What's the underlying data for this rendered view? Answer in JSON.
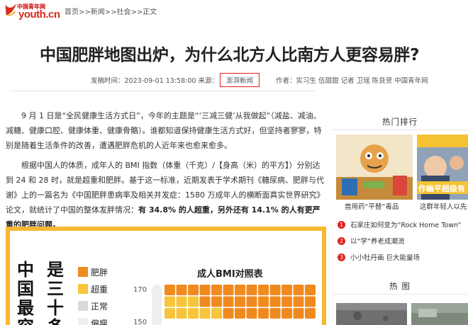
{
  "header": {
    "logo_cn": "中国青年网",
    "logo_en": "youth.cn",
    "breadcrumb": [
      "首页",
      ">>",
      "新闻",
      ">>",
      "社会",
      ">>",
      "正文"
    ]
  },
  "article": {
    "title": "中国肥胖地图出炉，为什么北方人比南方人更容易胖?",
    "publish_label": "发稿时间：",
    "publish_time": "2023-09-01 13:58:00",
    "source_label": "来源：",
    "source": "澎湃新闻",
    "author_label": "作者：",
    "authors": "实习生 伍甜甜 记者 卫瑶 陈良贤 中国青年网",
    "p1": "9 月 1 日是“全民健康生活方式日”，今年的主题是“‘三减三健’从我做起”（减盐、减油、减糖、健康口腔、健康体重、健康骨骼）。谁都知道保持健康生活方式好，但坚持者寥寥，特别是随着生活条件的改善，遭遇肥胖危机的人近年来也愈来愈多。",
    "p2_a": "根据中国人的体质，成年人的 BMI 指数（体重（千克）/【身高（米）的平方】）分别达到 24 和 28 时，就是超重和肥胖。基于这一标准，近期发表于学术期刊《糖尿病、肥胖与代谢》上的一篇名为《中国肥胖患病率及相关并发症：1580 万成年人的横断面真实世界研究》论文，就统计了中国的整体发胖情况：",
    "p2_b": "有 34.8% 的人超重，另外还有 14.1% 的人有更严重的肥胖问题。"
  },
  "infographic": {
    "vertical_a": "中国最容",
    "vertical_b": "是三十多",
    "legend": [
      {
        "label": "肥胖",
        "color": "#f08a1e"
      },
      {
        "label": "超重",
        "color": "#f7c43c"
      },
      {
        "label": "正常",
        "color": "#d9d9d9"
      },
      {
        "label": "偏瘦",
        "color": "#eeeeee"
      }
    ],
    "chart_title": "成人BMI对照表",
    "y_ticks": [
      "170",
      "150"
    ]
  },
  "sidebar": {
    "hot_title": "热门排行",
    "img_caption_1": "兽用药“平替”毒品",
    "img_caption_2": "这群年轻人以先",
    "ranks": [
      {
        "n": "1",
        "text": "石家庄如何变为“Rock Home Town”"
      },
      {
        "n": "2",
        "text": "以“学”养老成潮流"
      },
      {
        "n": "3",
        "text": "小小牡丹画 巨大能量场"
      }
    ],
    "photo_title": "热 图",
    "thumb2_overlay": "作幽平超级有"
  }
}
